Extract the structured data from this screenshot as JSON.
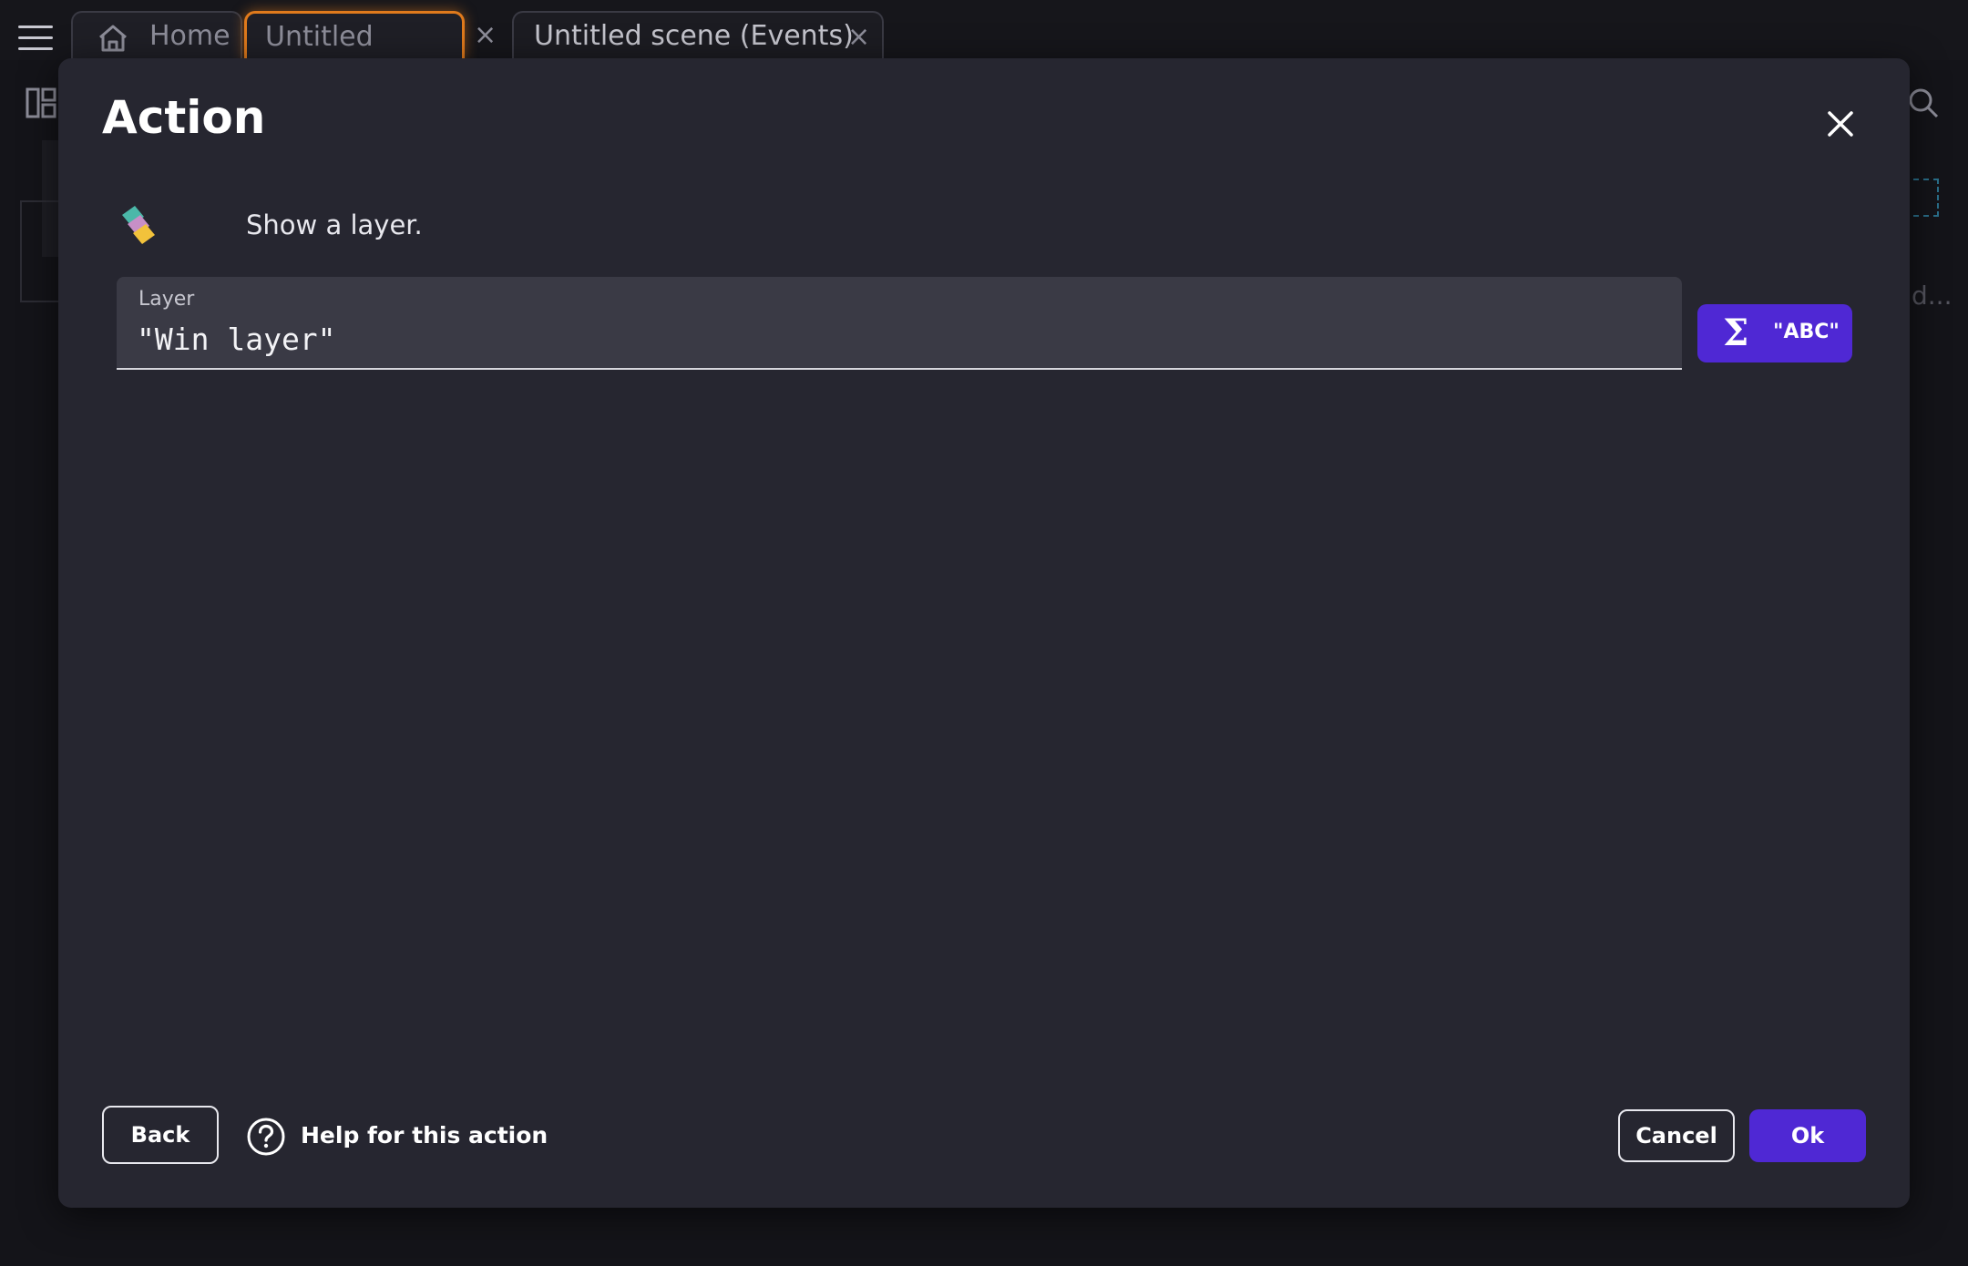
{
  "tabs": [
    {
      "label": "Home",
      "icon": "home-icon"
    },
    {
      "label": "Untitled scene",
      "close": "×",
      "active": true
    },
    {
      "label": "Untitled scene (Events)",
      "close": "×"
    }
  ],
  "background": {
    "truncated_text": "d..."
  },
  "dialog": {
    "title": "Action",
    "description": "Show a layer.",
    "field": {
      "label": "Layer",
      "value": "\"Win layer\""
    },
    "expression_button": {
      "label": "\"ABC\"",
      "symbol": "Σ"
    },
    "buttons": {
      "back": "Back",
      "help": "Help for this action",
      "cancel": "Cancel",
      "ok": "Ok"
    }
  },
  "colors": {
    "accent": "#4f28d4",
    "active_tab": "#e07a1c",
    "dialog_bg": "#262630",
    "field_bg": "#3a3a45"
  }
}
